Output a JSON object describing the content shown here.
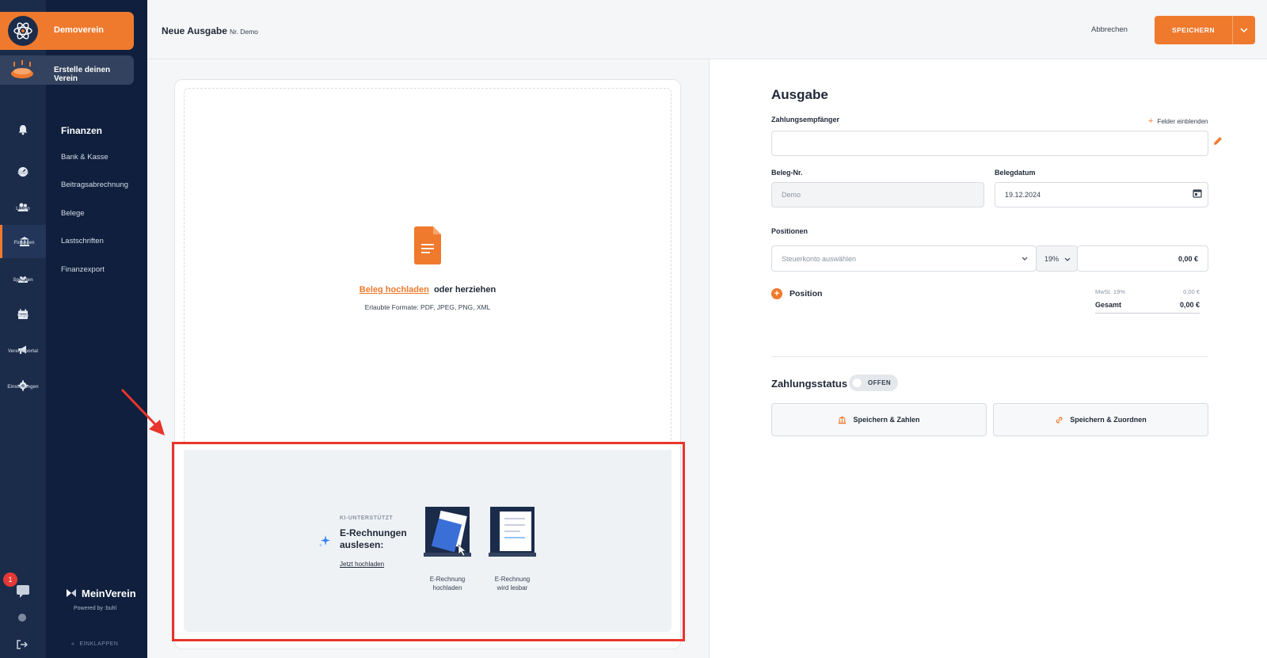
{
  "sidebar": {
    "org_name": "Demoverein",
    "create_label": "Erstelle deinen Verein",
    "rail": [
      {
        "label": "Start",
        "icon": "dashboard-icon"
      },
      {
        "label": "Listen",
        "icon": "users-icon"
      },
      {
        "label": "Finanzen",
        "icon": "bank-icon"
      },
      {
        "label": "Spenden",
        "icon": "donation-icon"
      },
      {
        "label": "Orga",
        "icon": "calendar-icon"
      },
      {
        "label": "Vereinsportal",
        "icon": "megaphone-icon"
      },
      {
        "label": "Einstellungen",
        "icon": "gear-icon"
      }
    ],
    "active_rail": "Finanzen",
    "section_title": "Finanzen",
    "sub_items": [
      "Bank & Kasse",
      "Beitragsabrechnung",
      "Belege",
      "Lastschriften",
      "Finanzexport"
    ],
    "notification_badge": "1",
    "brand": "MeinVerein",
    "powered_by": "Powered by  :buhl",
    "collapse_label": "EINKLAPPEN"
  },
  "header": {
    "title": "Neue Ausgabe",
    "subtitle": "Nr. Demo",
    "cancel_label": "Abbrechen",
    "save_label": "SPEICHERN"
  },
  "upload": {
    "link_label": "Beleg hochladen",
    "rest_label": "oder herziehen",
    "formats": "Erlaubte Formate: PDF, JPEG, PNG, XML"
  },
  "ki": {
    "tag": "KI-UNTERSTÜTZT",
    "title": "E-Rechnungen auslesen:",
    "link": "Jetzt hochladen",
    "steps": [
      {
        "caption_1": "E-Rechnung",
        "caption_2": "hochladen"
      },
      {
        "caption_1": "E-Rechnung",
        "caption_2": "wird lesbar"
      }
    ]
  },
  "form": {
    "heading": "Ausgabe",
    "payee_label": "Zahlungsempfänger",
    "payee_value": "",
    "show_fields_label": "Felder einblenden",
    "receipt_no_label": "Beleg-Nr.",
    "receipt_no_value": "Demo",
    "date_label": "Belegdatum",
    "date_value": "19.12.2024",
    "positions_label": "Positionen",
    "tax_account_placeholder": "Steuerkonto auswählen",
    "vat_rate": "19%",
    "amount": "0,00 €",
    "add_position_label": "Position",
    "vat_summary_label": "MwSt. 19%",
    "vat_summary_value": "0,00 €",
    "total_label": "Gesamt",
    "total_value": "0,00 €",
    "payment_status_label": "Zahlungsstatus",
    "payment_status_value": "OFFEN",
    "save_pay_label": "Speichern & Zahlen",
    "save_assign_label": "Speichern & Zuordnen"
  },
  "colors": {
    "accent": "#ef7a2e",
    "sidebar_dark": "#0f1f3d",
    "highlight": "#e8352b"
  }
}
